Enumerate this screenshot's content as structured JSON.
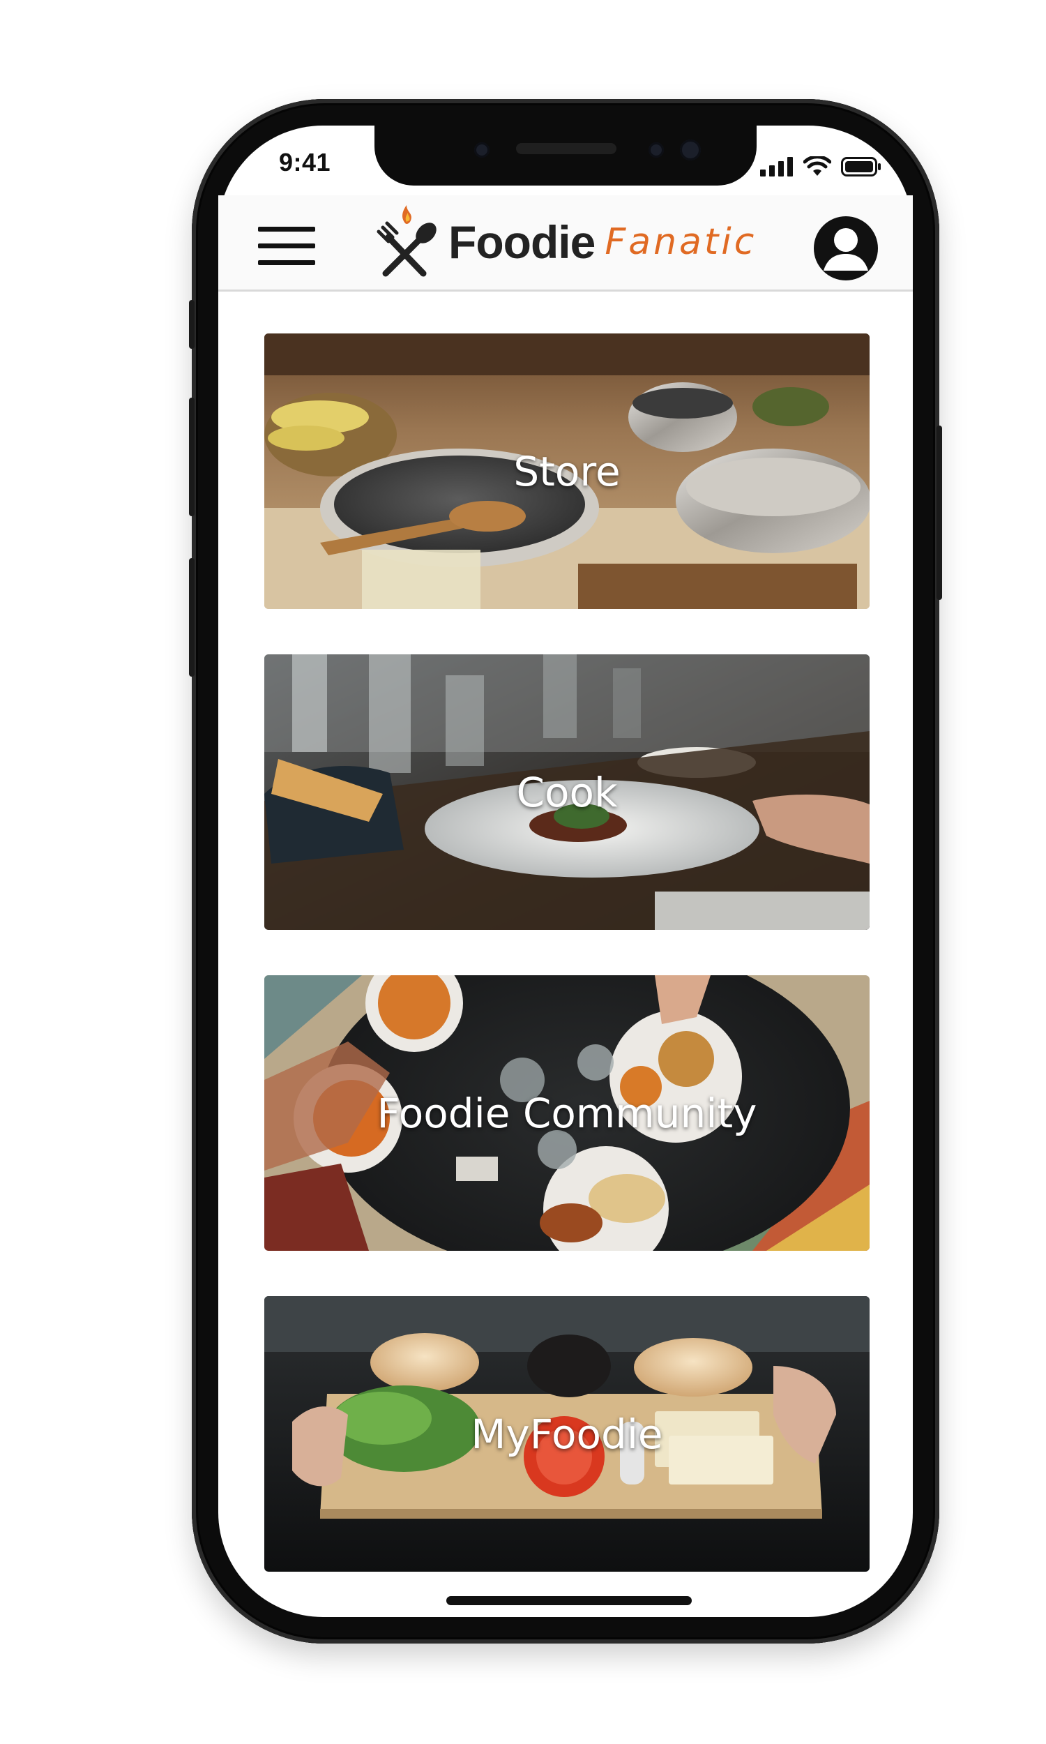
{
  "status_bar": {
    "time": "9:41"
  },
  "header": {
    "logo_word1": "Foodie",
    "logo_word2": "Fanatic",
    "accent_color": "#e06a23",
    "menu_icon": "hamburger-menu-icon",
    "profile_icon": "user-avatar-icon"
  },
  "cards": [
    {
      "label": "Store"
    },
    {
      "label": "Cook"
    },
    {
      "label": "Foodie Community"
    },
    {
      "label": "MyFoodie"
    }
  ]
}
